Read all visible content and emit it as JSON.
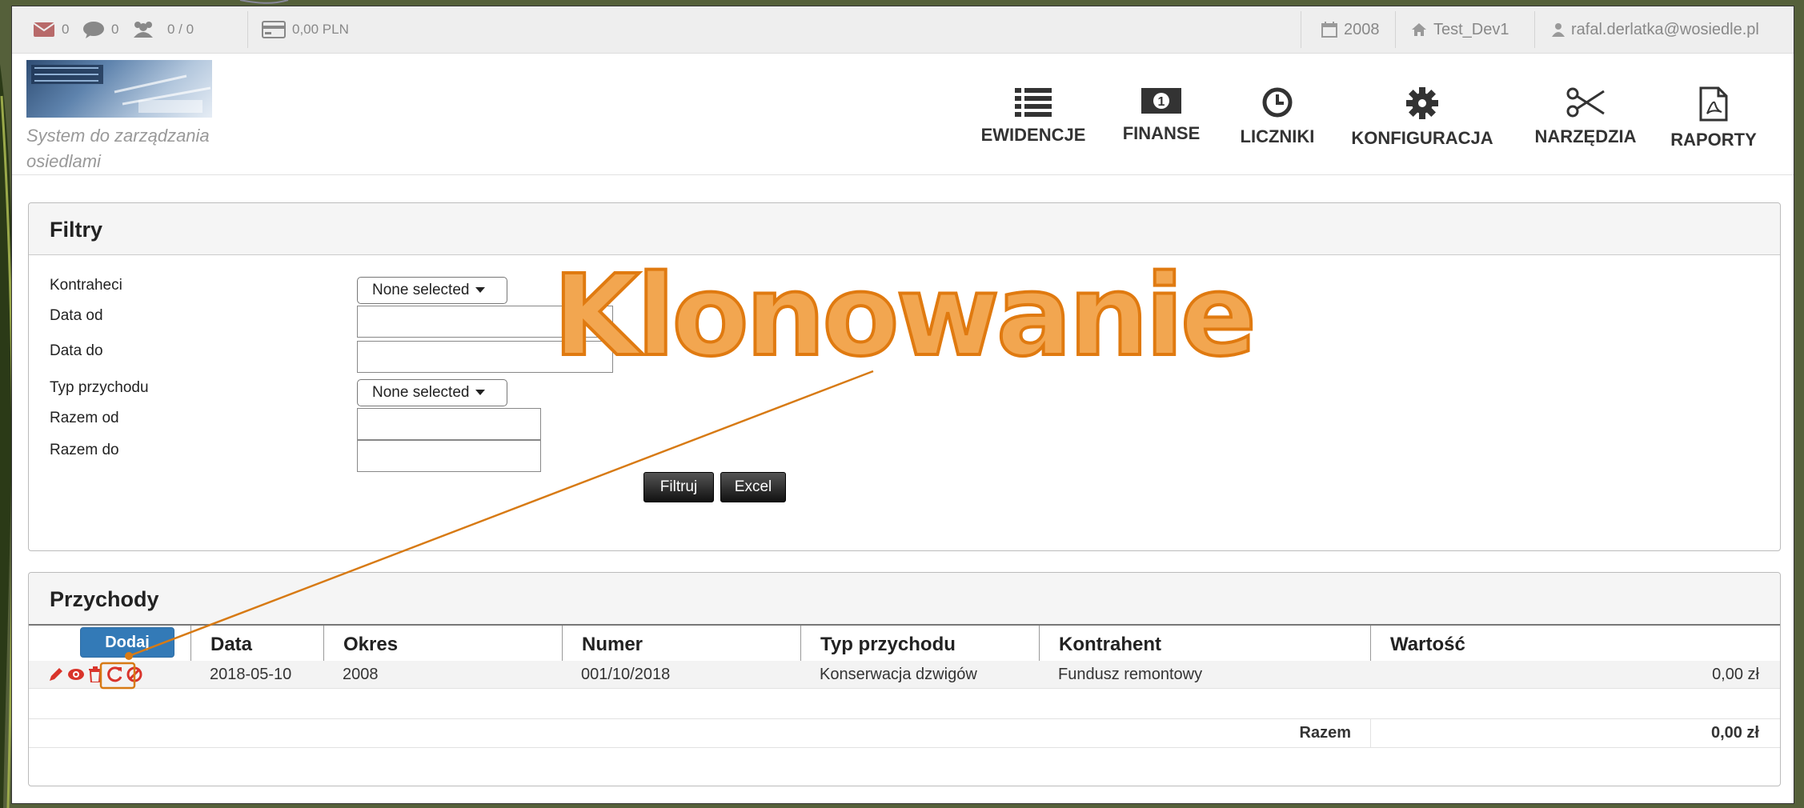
{
  "topbar": {
    "messages_count": "0",
    "comments_count": "0",
    "users_count": "0 / 0",
    "balance": "0,00 PLN",
    "year": "2008",
    "environment": "Test_Dev1",
    "user_email": "rafal.derlatka@wosiedle.pl"
  },
  "header": {
    "tagline": "System do zarządzania osiedlami",
    "nav": [
      {
        "label": "EWIDENCJE",
        "icon": "list-icon"
      },
      {
        "label": "FINANSE",
        "icon": "money-icon"
      },
      {
        "label": "LICZNIKI",
        "icon": "clock-icon"
      },
      {
        "label": "KONFIGURACJA",
        "icon": "gear-icon"
      },
      {
        "label": "NARZĘDZIA",
        "icon": "scissors-icon"
      },
      {
        "label": "RAPORTY",
        "icon": "pdf-icon"
      }
    ]
  },
  "filters": {
    "title": "Filtry",
    "fields": {
      "kontrahenci": {
        "label": "Kontraheci",
        "value": "None selected"
      },
      "data_od": {
        "label": "Data od",
        "value": ""
      },
      "data_do": {
        "label": "Data do",
        "value": ""
      },
      "typ_przychodu": {
        "label": "Typ przychodu",
        "value": "None selected"
      },
      "razem_od": {
        "label": "Razem od",
        "value": ""
      },
      "razem_do": {
        "label": "Razem do",
        "value": ""
      }
    },
    "filter_button": "Filtruj",
    "excel_button": "Excel"
  },
  "income": {
    "title": "Przychody",
    "add_button": "Dodaj",
    "columns": [
      "Data",
      "Okres",
      "Numer",
      "Typ przychodu",
      "Kontrahent",
      "Wartość"
    ],
    "rows": [
      {
        "data": "2018-05-10",
        "okres": "2008",
        "numer": "001/10/2018",
        "typ": "Konserwacja dzwigów",
        "kontrahent": "Fundusz remontowy",
        "wartosc": "0,00 zł",
        "actions": [
          "edit-icon",
          "view-icon",
          "delete-icon",
          "clone-icon",
          "cancel-icon"
        ]
      }
    ],
    "total_label": "Razem",
    "total_value": "0,00 zł"
  },
  "annotation": {
    "text": "Klonowanie",
    "color": "#e07a10"
  }
}
